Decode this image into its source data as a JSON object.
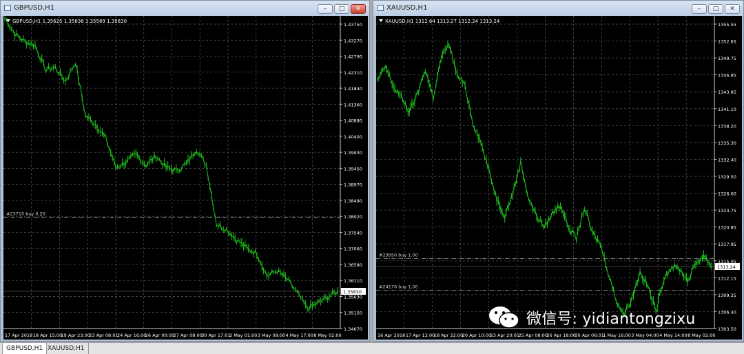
{
  "windows": [
    {
      "title": "GBPUSD,H1",
      "chart": {
        "header": "GBPUSD,H1  1.35625 1.35836 1.35589 1.35830",
        "price_labels": [
          "1.43750",
          "1.43270",
          "1.42790",
          "1.42310",
          "1.41840",
          "1.41360",
          "1.40880",
          "1.40400",
          "1.39930",
          "1.39450",
          "1.38970",
          "1.38490",
          "1.38020",
          "1.37540",
          "1.37060",
          "1.36580",
          "1.36110",
          "1.35630",
          "1.35150",
          "1.34670"
        ],
        "time_labels": [
          "17 Apr 2018",
          "18 Apr 15:00",
          "19 Apr 23:00",
          "23 Apr 08:01",
          "24 Apr 16:00",
          "26 Apr 00:00",
          "27 Apr 08:00",
          "30 Apr 17:01",
          "2 May 01:00",
          "3 May 09:00",
          "4 May 17:00",
          "8 May 02:00"
        ],
        "current_price": "1.35830",
        "order_line": {
          "label": "#23710 buy 0.20",
          "price": 1.379
        },
        "chart_data": {
          "type": "line",
          "series": [
            {
              "values": [
                1.437,
                1.4322,
                1.43,
                1.429,
                1.422,
                1.4225,
                1.4185,
                1.424,
                1.4085,
                1.406,
                1.402,
                1.3935,
                1.395,
                1.3972,
                1.3942,
                1.3968,
                1.3935,
                1.3925,
                1.3945,
                1.3988,
                1.394,
                1.377,
                1.3755,
                1.3725,
                1.37,
                1.3685,
                1.362,
                1.3635,
                1.361,
                1.357,
                1.3525,
                1.354,
                1.3558,
                1.3575
              ]
            }
          ],
          "ylim": [
            1.3467,
            1.4375
          ]
        }
      }
    },
    {
      "title": "XAUUSD,H1",
      "chart": {
        "header": "XAUUSD,H1  1312.64 1313.27 1312.24 1313.24",
        "price_labels": [
          "1355.55",
          "1352.65",
          "1349.75",
          "1346.85",
          "1343.95",
          "1341.10",
          "1338.20",
          "1335.30",
          "1332.40",
          "1329.50",
          "1326.60",
          "1323.75",
          "1320.85",
          "1317.95",
          "1315.05",
          "1312.15",
          "1309.25",
          "1306.40",
          "1303.50"
        ],
        "time_labels": [
          "16 Apr 2018",
          "17 Apr 12:00",
          "18 Apr 22:00",
          "20 Apr 10:00",
          "23 Apr 20:01",
          "25 Apr 08:00",
          "26 Apr 18:00",
          "30 Apr 06:01",
          "1 May 16:00",
          "3 May 04:00",
          "4 May 14:00",
          "8 May 02:00"
        ],
        "current_price": "1313.24",
        "order_lines": [
          {
            "label": "#23950 buy 1.00",
            "price": 1314.4
          },
          {
            "label": "#24176 buy 1.00",
            "price": 1308.8
          }
        ],
        "chart_data": {
          "type": "line",
          "series": [
            {
              "values": [
                1346.0,
                1348.5,
                1345.0,
                1343.0,
                1340.5,
                1343.5,
                1348.0,
                1343.0,
                1350.0,
                1352.5,
                1347.0,
                1345.0,
                1338.5,
                1335.0,
                1330.0,
                1325.0,
                1322.0,
                1326.0,
                1331.5,
                1325.0,
                1322.0,
                1320.0,
                1322.5,
                1324.0,
                1320.0,
                1318.0,
                1323.5,
                1319.0,
                1317.0,
                1312.0,
                1307.0,
                1304.5,
                1307.5,
                1312.0,
                1309.5,
                1305.0,
                1311.0,
                1313.0,
                1312.5,
                1310.5,
                1313.5,
                1315.0,
                1313.0
              ]
            }
          ],
          "ylim": [
            1302.0,
            1357.5
          ]
        }
      }
    }
  ],
  "tabs": [
    "GBPUSD,H1",
    "XAUUSD,H1"
  ],
  "watermark": {
    "text": "微信号: yidiantongzixu"
  },
  "colors": {
    "background": "#000000",
    "grid": "#5a5a5a",
    "candle": "#1fc21f",
    "axis_text": "#ffffff",
    "tag_bg": "#ffffff"
  }
}
